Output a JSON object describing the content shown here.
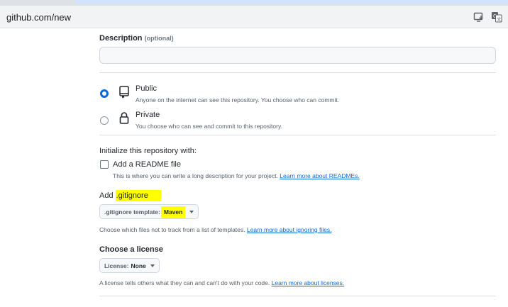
{
  "browser": {
    "url": "github.com/new",
    "icons": [
      "install-app-icon",
      "translate-icon"
    ]
  },
  "description": {
    "label": "Description",
    "optional": "(optional)",
    "value": ""
  },
  "visibility": {
    "selected": "public",
    "options": [
      {
        "id": "public",
        "title": "Public",
        "desc": "Anyone on the internet can see this repository. You choose who can commit.",
        "icon": "repo-icon"
      },
      {
        "id": "private",
        "title": "Private",
        "desc": "You choose who can see and commit to this repository.",
        "icon": "lock-icon"
      }
    ]
  },
  "initialize": {
    "heading": "Initialize this repository with:",
    "readme": {
      "label": "Add a README file",
      "checked": false,
      "desc": "This is where you can write a long description for your project.",
      "link": "Learn more about READMEs."
    }
  },
  "gitignore": {
    "heading_prefix": "Add",
    "heading_highlight": ".gitignore",
    "select_label": ".gitignore template:",
    "select_value": "Maven",
    "desc": "Choose which files not to track from a list of templates.",
    "link": "Learn more about ignoring files."
  },
  "license": {
    "heading": "Choose a license",
    "select_label": "License:",
    "select_value": "None",
    "desc": "A license tells others what they can and can't do with your code.",
    "link": "Learn more about licenses."
  },
  "colors": {
    "accent": "#0969da",
    "highlight": "#ffff00"
  }
}
